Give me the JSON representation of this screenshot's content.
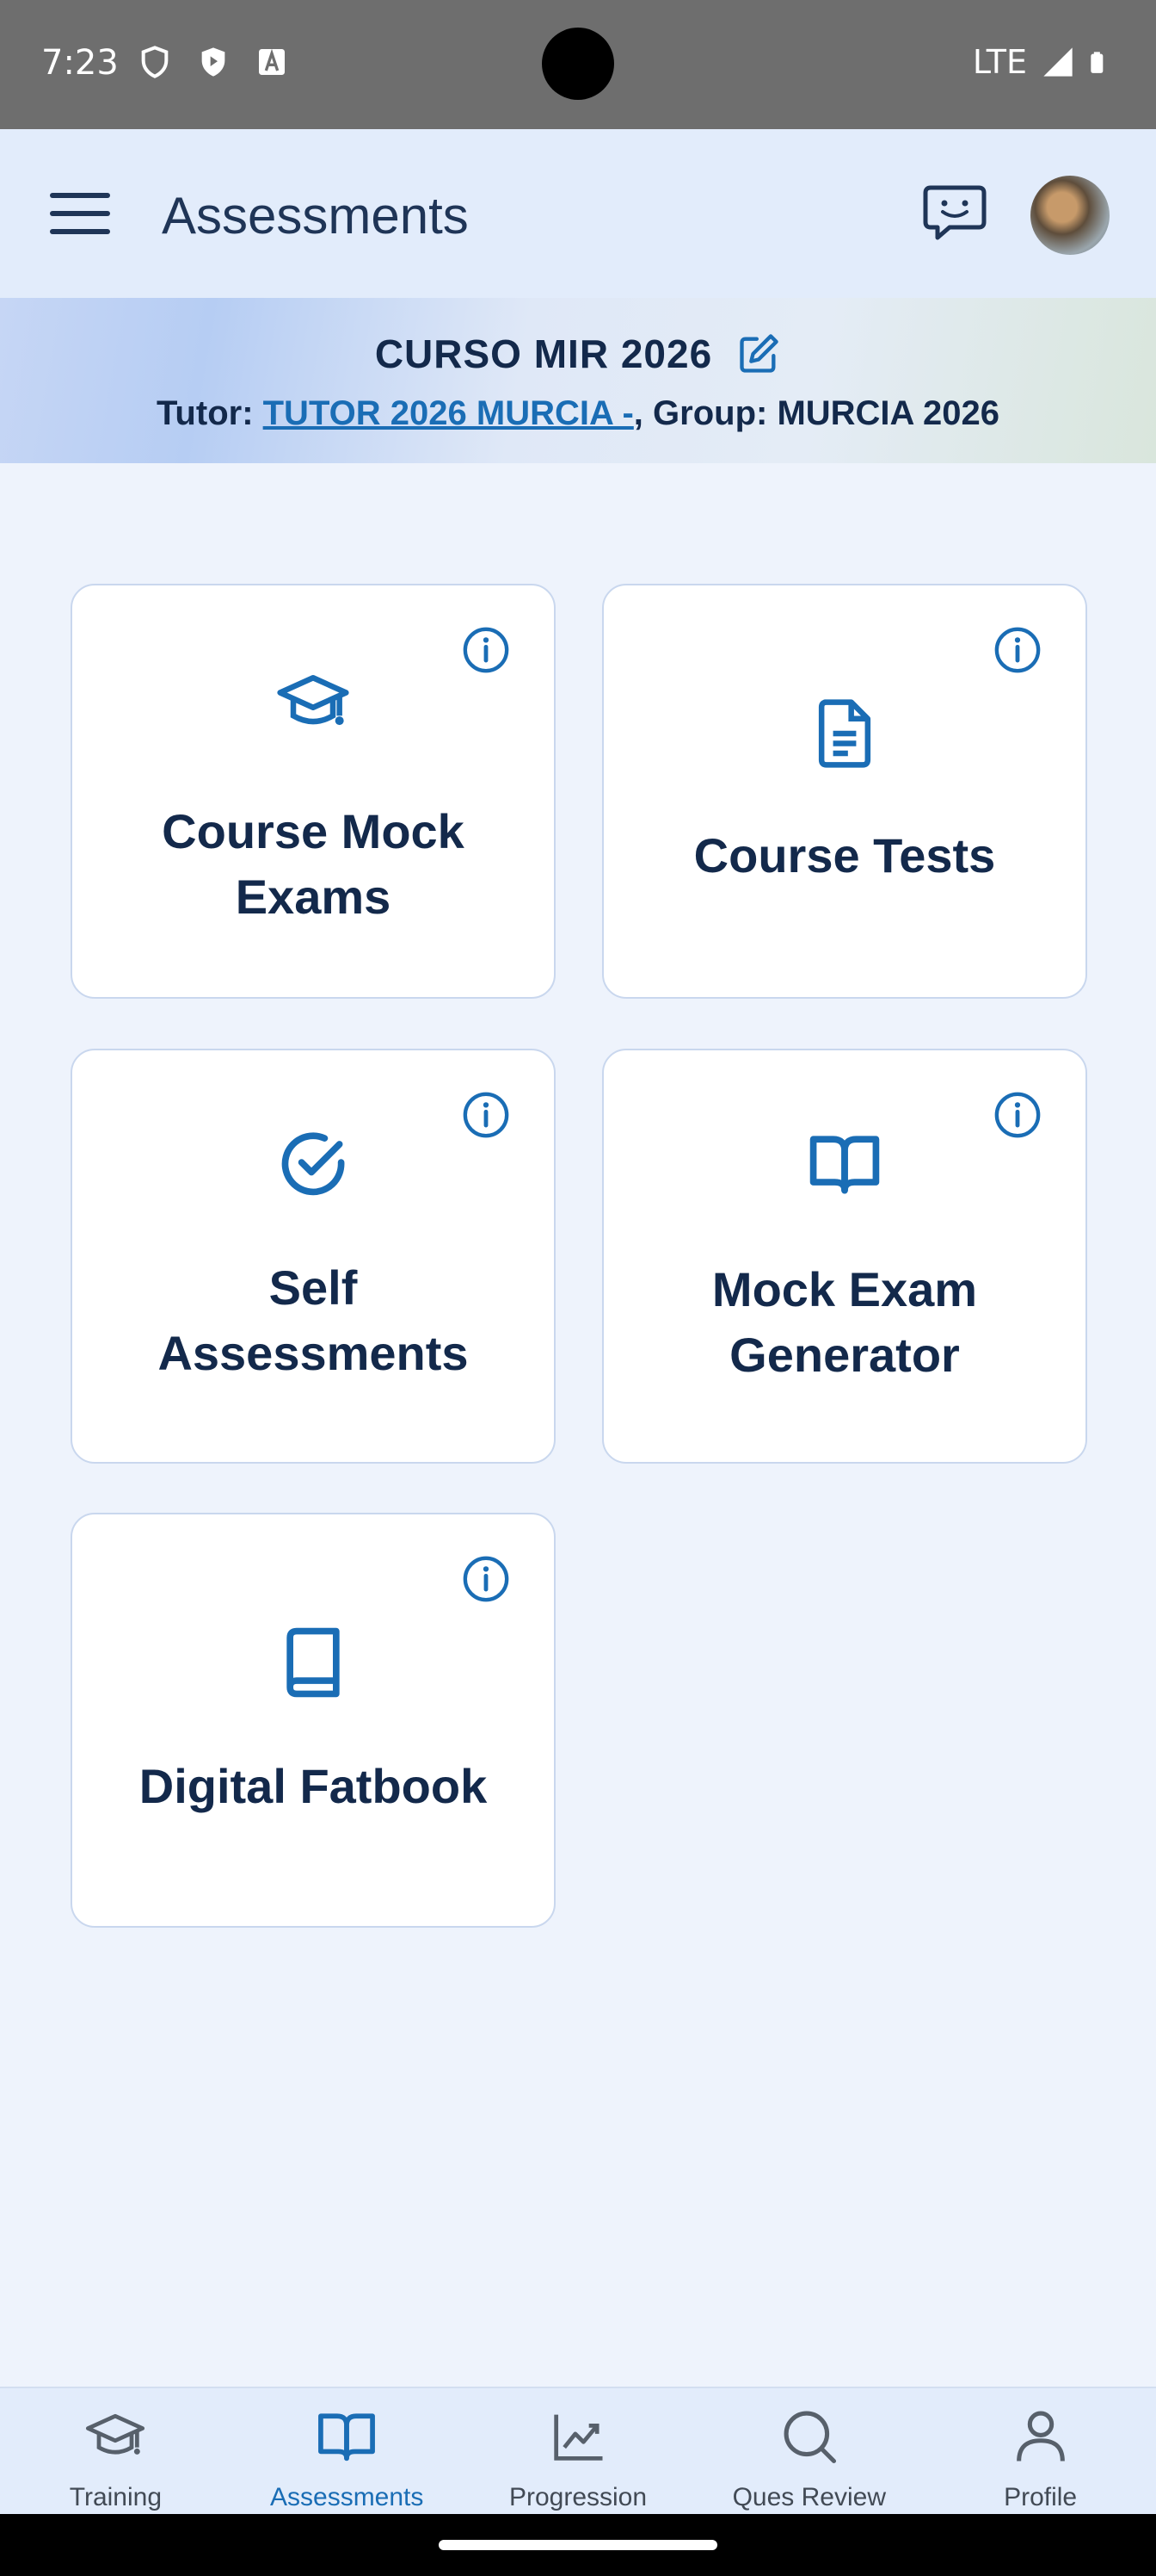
{
  "status_bar": {
    "time": "7:23",
    "network": "LTE"
  },
  "app_bar": {
    "title": "Assessments"
  },
  "course": {
    "name": "CURSO MIR 2026",
    "tutor_prefix": "Tutor: ",
    "tutor_name": "TUTOR 2026 MURCIA -",
    "group_text": ", Group: MURCIA 2026"
  },
  "cards": [
    {
      "label_line1": "Course Mock",
      "label_line2": "Exams",
      "icon": "graduation-cap-icon"
    },
    {
      "label": "Course Tests",
      "icon": "document-icon"
    },
    {
      "label_line1": "Self",
      "label_line2": "Assessments",
      "icon": "check-circle-icon"
    },
    {
      "label_line1": "Mock Exam",
      "label_line2": "Generator",
      "icon": "open-book-icon"
    },
    {
      "label": "Digital Fatbook",
      "icon": "book-icon"
    }
  ],
  "bottom_nav": [
    {
      "label": "Training",
      "icon": "graduation-cap-icon",
      "active": false
    },
    {
      "label": "Assessments",
      "icon": "open-book-icon",
      "active": true
    },
    {
      "label": "Progression",
      "icon": "chart-icon",
      "active": false
    },
    {
      "label": "Ques Review",
      "icon": "search-icon",
      "active": false
    },
    {
      "label": "Profile",
      "icon": "person-icon",
      "active": false
    }
  ],
  "colors": {
    "accent": "#1a6db5",
    "text": "#13294b",
    "background": "#eef3fc",
    "card_border": "#c9d7ee"
  }
}
